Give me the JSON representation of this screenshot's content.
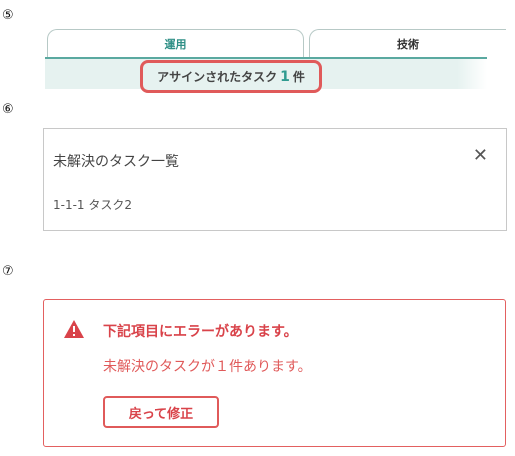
{
  "markers": {
    "five": "⑤",
    "six": "⑥",
    "seven": "⑦"
  },
  "tabs": [
    {
      "label": "運用"
    },
    {
      "label": "技術"
    }
  ],
  "assigned": {
    "prefix": "アサインされたタスク",
    "count": "1",
    "suffix": "件"
  },
  "modal": {
    "title": "未解決のタスク一覧",
    "close": "✕",
    "items": [
      "1-1-1 タスク2"
    ]
  },
  "error": {
    "heading": "下記項目にエラーがあります。",
    "message": "未解決のタスクが１件あります。",
    "button": "戻って修正"
  },
  "colors": {
    "accent": "#2f8f86",
    "tab_panel": "#e6f2f0",
    "error": "#e05a5a",
    "error_heading": "#d9434a"
  }
}
